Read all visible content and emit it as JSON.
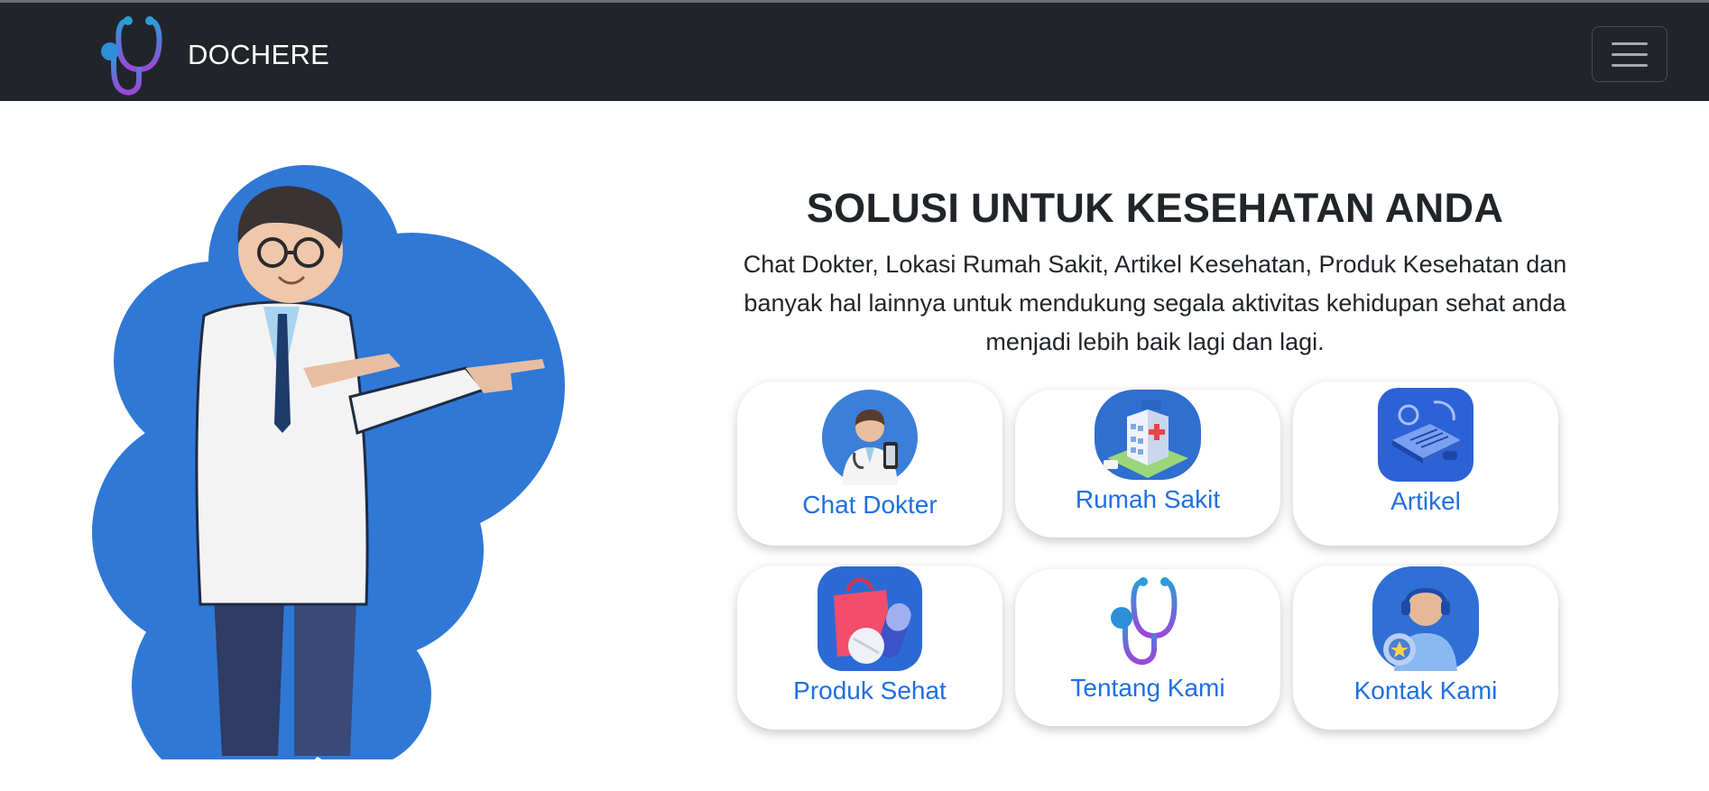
{
  "brand": {
    "name": "DOCHERE",
    "logo": "stethoscope-icon"
  },
  "navbar": {
    "toggle": "hamburger-icon",
    "background": "#212529"
  },
  "hero": {
    "title": "SOLUSI UNTUK KESEHATAN ANDA",
    "description": "Chat Dokter, Lokasi Rumah Sakit, Artikel Kesehatan, Produk Kesehatan dan banyak hal lainnya untuk mendukung segala aktivitas kehidupan sehat anda menjadi lebih baik lagi dan lagi.",
    "illustration": "doctor-pointing-illustration"
  },
  "services": [
    {
      "label": "Chat Dokter",
      "icon": "doctor-icon"
    },
    {
      "label": "Rumah Sakit",
      "icon": "hospital-icon"
    },
    {
      "label": "Artikel",
      "icon": "article-icon"
    },
    {
      "label": "Produk Sehat",
      "icon": "medicine-bag-icon"
    },
    {
      "label": "Tentang Kami",
      "icon": "stethoscope-icon"
    },
    {
      "label": "Kontak Kami",
      "icon": "support-agent-icon"
    }
  ],
  "colors": {
    "accent": "#1f6fe5",
    "blob": "#2f78d6",
    "text": "#212529"
  }
}
